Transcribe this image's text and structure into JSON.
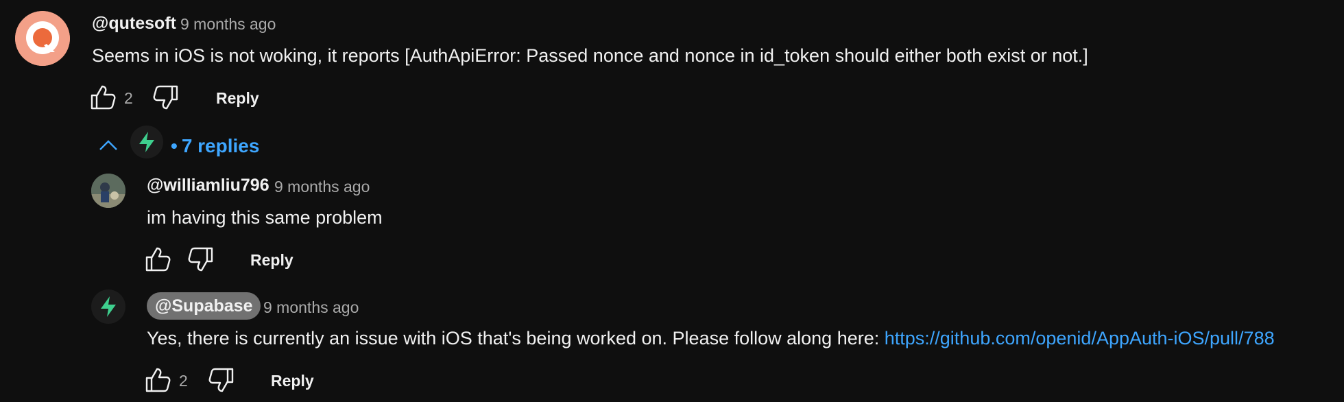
{
  "comments": [
    {
      "handle": "@qutesoft",
      "time": "9 months ago",
      "text": "Seems in iOS is not woking, it reports [AuthApiError: Passed nonce and nonce in id_token should either both exist or not.]",
      "likes": "2",
      "reply_label": "Reply"
    }
  ],
  "thread": {
    "replies_label": "7 replies",
    "separator": "•"
  },
  "replies": [
    {
      "handle": "@williamliu796",
      "time": "9 months ago",
      "text": "im having this same problem",
      "reply_label": "Reply"
    },
    {
      "handle": "@Supabase",
      "time": "9 months ago",
      "text": "Yes, there is currently an issue with iOS that's being worked on. Please follow along here: ",
      "link": "https://github.com/openid/AppAuth-iOS/pull/788",
      "likes": "2",
      "reply_label": "Reply"
    }
  ],
  "colors": {
    "background": "#0f0f0f",
    "link": "#3ea6ff",
    "supabase_green": "#3ecf8e",
    "qutesoft_orange": "#ec6a3c"
  }
}
